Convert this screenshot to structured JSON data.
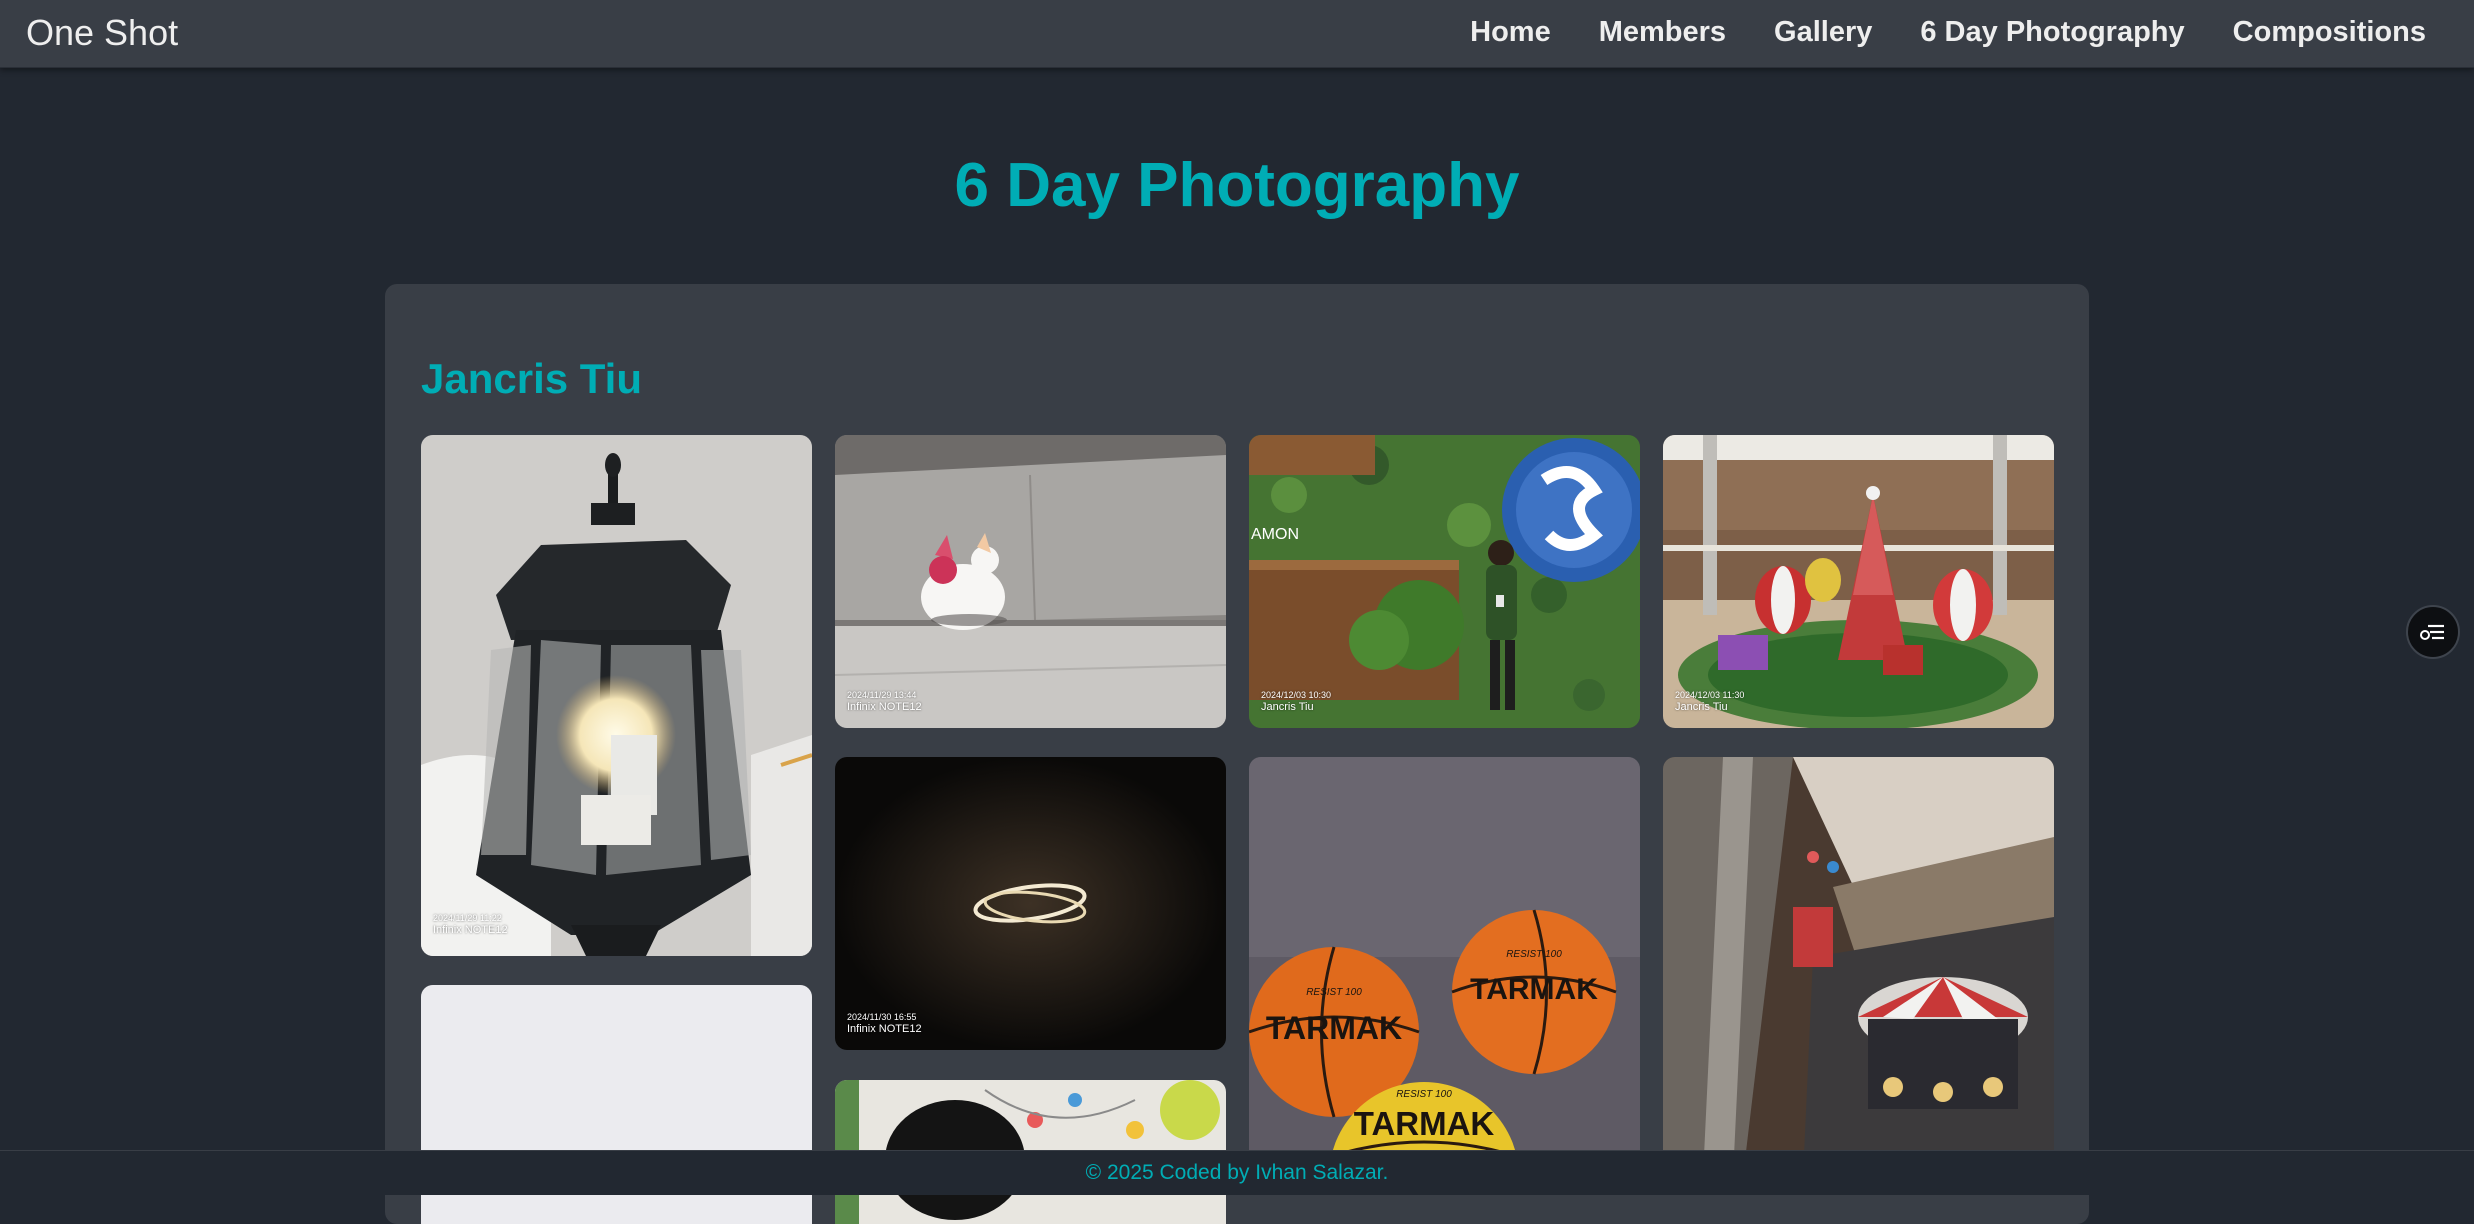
{
  "nav": {
    "brand": "One Shot",
    "links": [
      "Home",
      "Members",
      "Gallery",
      "6 Day Photography",
      "Compositions"
    ]
  },
  "page": {
    "title": "6 Day Photography",
    "member_name": "Jancris Tiu"
  },
  "photos": [
    {
      "subject": "lantern",
      "timestamp": "2024/11/29 11:22",
      "device": "Infinix NOTE12"
    },
    {
      "subject": "cat-figurine",
      "timestamp": "2024/11/29 13:44",
      "device": "Infinix NOTE12"
    },
    {
      "subject": "person-at-wall",
      "timestamp": "2024/12/03 10:30",
      "device": "Jancris Tiu",
      "sign_text": "AMON"
    },
    {
      "subject": "mall-christmas-display",
      "timestamp": "2024/12/03 11:30",
      "device": "Jancris Tiu"
    },
    {
      "subject": "ring-lights",
      "timestamp": "2024/11/30 16:55",
      "device": "Infinix NOTE12"
    },
    {
      "subject": "basketballs",
      "ball_label": "TARMAK",
      "ball_sublabel": "RESIST 100"
    },
    {
      "subject": "mall-carousel"
    },
    {
      "subject": "white-wall"
    },
    {
      "subject": "person-near-mural"
    }
  ],
  "footer": {
    "text": "© 2025 Coded by Ivhan Salazar."
  },
  "colors": {
    "background": "#222831",
    "surface": "#393e46",
    "accent": "#00adb5",
    "text": "#eeeeee"
  },
  "icons": {
    "float_button": "filter-list-icon"
  }
}
